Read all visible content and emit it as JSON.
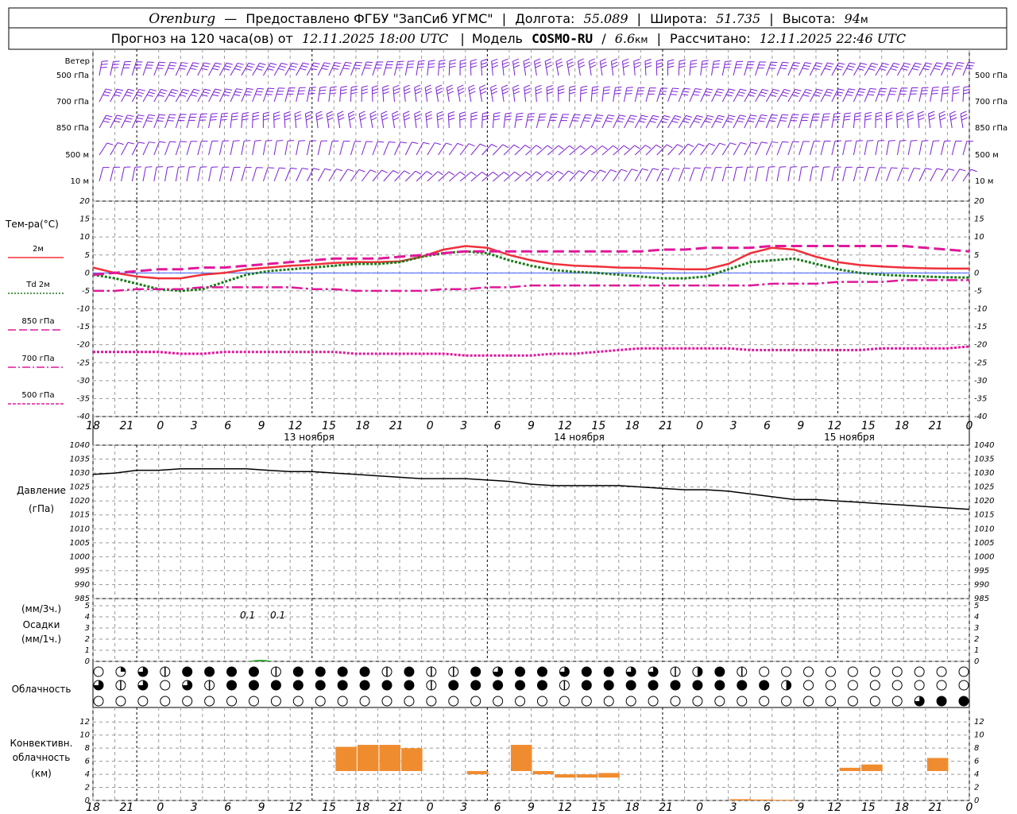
{
  "header": {
    "line1": {
      "station": "Orenburg",
      "dash": "—",
      "provider": "Предоставлено ФГБУ \"ЗапСиб УГМС\"",
      "sep": "|",
      "lon_label": "Долгота:",
      "lon_value": "55.089",
      "lat_label": "Широта:",
      "lat_value": "51.735",
      "alt_label": "Высота:",
      "alt_value": "94",
      "alt_unit": "м"
    },
    "line2": {
      "forecast_label": "Прогноз на 120 часа(ов) от",
      "forecast_start": "12.11.2025 18:00 UTC",
      "model_label": "Модель",
      "model_name": "COSMO-RU",
      "model_res": "6.6",
      "model_res_unit": "км",
      "calc_label": "Рассчитано:",
      "calc_time": "12.11.2025 22:46 UTC"
    }
  },
  "wind_panel": {
    "title": "Ветер",
    "levels": [
      "500 гПа",
      "700 гПа",
      "850 гПа",
      "500 м",
      "10 м"
    ],
    "color": "#7b1fd6"
  },
  "temp_panel": {
    "title": "Тем-ра(°C)",
    "legend": [
      {
        "label": "2м",
        "color": "#f0303a",
        "style": "solid"
      },
      {
        "label": "Td 2м",
        "color": "#1c7a1c",
        "style": "dotted"
      },
      {
        "label": "850 гПа",
        "color": "#e0189a",
        "style": "dash"
      },
      {
        "label": "700 гПа",
        "color": "#e0189a",
        "style": "dashdot"
      },
      {
        "label": "500 гПа",
        "color": "#e0189a",
        "style": "dot"
      }
    ],
    "yticks": [
      "20",
      "15",
      "10",
      "5",
      "0",
      "-5",
      "-10",
      "-15",
      "-20",
      "-25",
      "-30",
      "-35",
      "-40"
    ]
  },
  "time_axis": {
    "hour_labels": [
      "18",
      "21",
      "0",
      "3",
      "6",
      "9",
      "12",
      "15",
      "18",
      "21",
      "0",
      "3",
      "6",
      "9",
      "12",
      "15",
      "18",
      "21",
      "0",
      "3",
      "6",
      "9",
      "12",
      "15",
      "18",
      "21",
      "0"
    ],
    "day_labels": [
      "13 ноября",
      "14 ноября",
      "15 ноября"
    ]
  },
  "pressure_panel": {
    "title": "Давление",
    "unit": "(гПа)",
    "yticks": [
      "1040",
      "1035",
      "1030",
      "1025",
      "1020",
      "1015",
      "1010",
      "1005",
      "1000",
      "995",
      "990",
      "985"
    ]
  },
  "precip_panel": {
    "label_3h": "(мм/3ч.)",
    "title": "Осадки",
    "label_1h": "(мм/1ч.)",
    "yticks": [
      "5",
      "4",
      "3",
      "2",
      "1",
      "0"
    ],
    "annotations": [
      "0.1",
      "0.1"
    ]
  },
  "cloud_panel": {
    "title": "Облачность"
  },
  "conv_panel": {
    "title_lines": [
      "Конвективн.",
      "облачность",
      "(км)"
    ],
    "yticks": [
      "12",
      "10",
      "8",
      "6",
      "4",
      "2",
      "0"
    ],
    "bar_color": "#f08c30"
  },
  "chart_data": [
    {
      "type": "line",
      "title": "Тем-ра(°C)",
      "x_hours": [
        0,
        3,
        6,
        9,
        12,
        15,
        18,
        21,
        24,
        27,
        30,
        33,
        36,
        39,
        42,
        45,
        48,
        51,
        54,
        57,
        60,
        63,
        66,
        69,
        72,
        75,
        78,
        81,
        84,
        87,
        90,
        93,
        96,
        99,
        102,
        105,
        108,
        111,
        114,
        117,
        120
      ],
      "ylim": [
        -40,
        20
      ],
      "series": [
        {
          "name": "2м",
          "values": [
            1.5,
            0,
            -1,
            -1.5,
            -1.5,
            -0.5,
            0,
            1,
            1.5,
            2,
            2.3,
            2.8,
            3,
            3,
            3.2,
            4.5,
            6.5,
            7.5,
            7,
            5,
            3.5,
            2.5,
            2,
            1.8,
            1.5,
            1.4,
            1.2,
            1,
            1,
            2.5,
            5.5,
            7,
            6.5,
            4.5,
            3,
            2.2,
            1.8,
            1.5,
            1.3,
            1.2,
            1.2
          ]
        },
        {
          "name": "Td 2м",
          "values": [
            -0.5,
            -1.5,
            -3,
            -4.5,
            -5,
            -4.5,
            -2.5,
            -0.5,
            0.5,
            1,
            1.5,
            2,
            2.5,
            2.5,
            3,
            4.5,
            5.5,
            6,
            5.5,
            3.5,
            2,
            0.8,
            0.3,
            0,
            -0.5,
            -1,
            -1.5,
            -1.5,
            -1,
            1,
            3,
            3.5,
            4,
            2.5,
            1,
            0,
            -0.5,
            -0.8,
            -1,
            -1.2,
            -1.3
          ]
        },
        {
          "name": "850 гПа",
          "values": [
            -0.5,
            0,
            0.5,
            1,
            1,
            1.5,
            1.5,
            2,
            2.5,
            3,
            3.5,
            4,
            4,
            4,
            4.5,
            5,
            5.5,
            6,
            6,
            6,
            6,
            6,
            6,
            6,
            6,
            6,
            6.5,
            6.5,
            7,
            7,
            7,
            7.5,
            7.5,
            7.5,
            7.5,
            7.5,
            7.5,
            7.5,
            7,
            6.5,
            6
          ]
        },
        {
          "name": "700 гПа",
          "values": [
            -5,
            -5,
            -4.5,
            -4.5,
            -4.5,
            -4,
            -4,
            -4,
            -4,
            -4,
            -4.5,
            -4.5,
            -5,
            -5,
            -5,
            -5,
            -4.5,
            -4.5,
            -4,
            -4,
            -3.5,
            -3.5,
            -3.5,
            -3.5,
            -3.5,
            -3.5,
            -3.5,
            -3.5,
            -3.5,
            -3.5,
            -3.5,
            -3,
            -3,
            -3,
            -2.5,
            -2.5,
            -2.5,
            -2,
            -2,
            -2,
            -2
          ]
        },
        {
          "name": "500 гПа",
          "values": [
            -22,
            -22,
            -22,
            -22,
            -22.5,
            -22.5,
            -22,
            -22,
            -22,
            -22,
            -22,
            -22,
            -22.5,
            -22.5,
            -22.5,
            -22.5,
            -22.5,
            -23,
            -23,
            -23,
            -23,
            -22.5,
            -22.5,
            -22,
            -21.5,
            -21,
            -21,
            -21,
            -21,
            -21,
            -21.5,
            -21.5,
            -21.5,
            -21.5,
            -21.5,
            -21.5,
            -21,
            -21,
            -21,
            -21,
            -20.5
          ]
        }
      ]
    },
    {
      "type": "line",
      "title": "Давление",
      "x_hours": [
        0,
        3,
        6,
        9,
        12,
        15,
        18,
        21,
        24,
        27,
        30,
        33,
        36,
        39,
        42,
        45,
        48,
        51,
        54,
        57,
        60,
        63,
        66,
        69,
        72,
        75,
        78,
        81,
        84,
        87,
        90,
        93,
        96,
        99,
        102,
        105,
        108,
        111,
        114,
        117,
        120
      ],
      "ylim": [
        985,
        1040
      ],
      "series": [
        {
          "name": "Давление",
          "values": [
            1029.5,
            1030,
            1031,
            1031,
            1031.5,
            1031.5,
            1031.5,
            1031.5,
            1031,
            1030.5,
            1030.5,
            1030,
            1029.5,
            1029,
            1028.5,
            1028,
            1028,
            1028,
            1027.5,
            1027,
            1026,
            1025.5,
            1025.5,
            1025.5,
            1025.5,
            1025,
            1024.5,
            1024,
            1024,
            1023.5,
            1022.5,
            1021.5,
            1020.5,
            1020.5,
            1020,
            1019.5,
            1019,
            1018.5,
            1018,
            1017.5,
            1017
          ]
        }
      ]
    },
    {
      "type": "bar",
      "title": "Конвективн. облачность (км)",
      "ylim": [
        0,
        13
      ],
      "bars": [
        {
          "hour": 12,
          "bottom": 4.5,
          "top": 8.2
        },
        {
          "hour": 13,
          "bottom": 4.5,
          "top": 8.5
        },
        {
          "hour": 14,
          "bottom": 4.5,
          "top": 8.5
        },
        {
          "hour": 15,
          "bottom": 4.5,
          "top": 8.0
        },
        {
          "hour": 18,
          "bottom": 4.0,
          "top": 4.5
        },
        {
          "hour": 20,
          "bottom": 4.5,
          "top": 8.5
        },
        {
          "hour": 21,
          "bottom": 4.0,
          "top": 4.5
        },
        {
          "hour": 22,
          "bottom": 3.5,
          "top": 4.0
        },
        {
          "hour": 23,
          "bottom": 3.5,
          "top": 4.0
        },
        {
          "hour": 24,
          "bottom": 3.5,
          "top": 4.2
        },
        {
          "hour": 30,
          "bottom": 0,
          "top": 0.2
        },
        {
          "hour": 31,
          "bottom": 0,
          "top": 0.15
        },
        {
          "hour": 32,
          "bottom": 0,
          "top": 0.1
        },
        {
          "hour": 35,
          "bottom": 4.5,
          "top": 5.0
        },
        {
          "hour": 36,
          "bottom": 4.5,
          "top": 5.5
        },
        {
          "hour": 39,
          "bottom": 4.5,
          "top": 6.5
        }
      ]
    }
  ]
}
